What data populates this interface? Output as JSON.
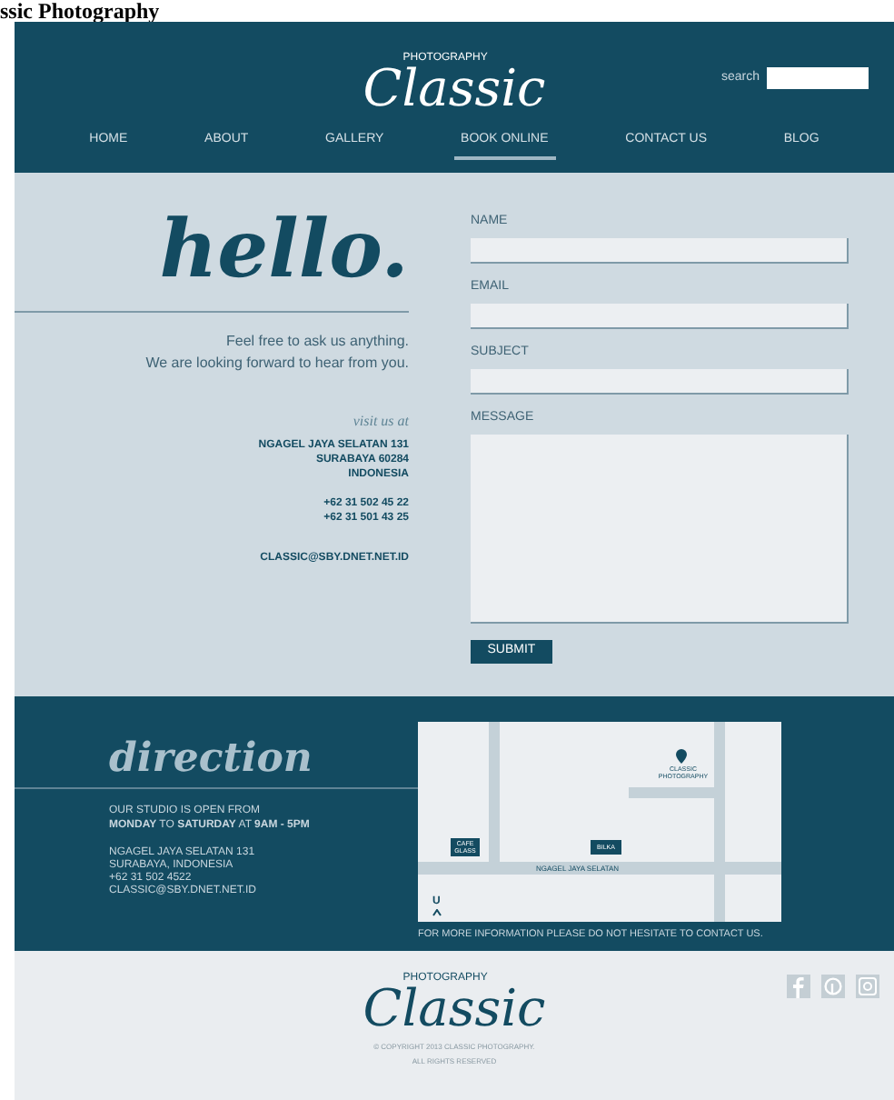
{
  "page_title": "ssic Photography",
  "header": {
    "logo": {
      "word": "Classic",
      "tag": "PHOTOGRAPHY"
    },
    "search": {
      "label": "search"
    },
    "nav": [
      {
        "label": "HOME",
        "selected": false
      },
      {
        "label": "ABOUT",
        "selected": false
      },
      {
        "label": "GALLERY",
        "selected": false
      },
      {
        "label": "BOOK ONLINE",
        "selected": true
      },
      {
        "label": "CONTACT US",
        "selected": false
      },
      {
        "label": "BLOG",
        "selected": false
      }
    ]
  },
  "contact": {
    "heading": "hello.",
    "intro": [
      "Feel free to ask us anything.",
      "We are looking forward to hear from you."
    ],
    "visit_label": "visit us at",
    "address": [
      "NGAGEL JAYA SELATAN 131",
      "SURABAYA 60284",
      "INDONESIA"
    ],
    "phones": [
      "+62 31 502 45 22",
      "+62 31 501 43 25"
    ],
    "email": "CLASSIC@SBY.DNET.NET.ID",
    "form": {
      "fields": [
        {
          "label": "NAME",
          "kind": "line"
        },
        {
          "label": "EMAIL",
          "kind": "line"
        },
        {
          "label": "SUBJECT",
          "kind": "line"
        },
        {
          "label": "MESSAGE",
          "kind": "area"
        }
      ],
      "submit": "SUBMIT"
    }
  },
  "direction": {
    "heading": "direction",
    "hours": "OUR STUDIO IS OPEN FROM\n**MONDAY** TO **SATURDAY** AT **9AM - 5PM**",
    "address": [
      "NGAGEL JAYA SELATAN 131",
      "SURABAYA, INDONESIA",
      "+62 31 502 4522",
      "CLASSIC@SBY.DNET.NET.ID"
    ],
    "map": {
      "studio": "CLASSIC PHOTOGRAPHY",
      "places": [
        "CAFE GLASS",
        "BILKA"
      ],
      "street": "NGAGEL JAYA SELATAN",
      "north": "U"
    },
    "note": "FOR MORE INFORMATION PLEASE DO NOT HESITATE TO CONTACT US."
  },
  "footer": {
    "logo": {
      "word": "Classic",
      "tag": "PHOTOGRAPHY"
    },
    "copyright": "© COPYRIGHT 2013 CLASSIC PHOTOGRAPHY.",
    "rights": "ALL RIGHTS RESERVED"
  }
}
